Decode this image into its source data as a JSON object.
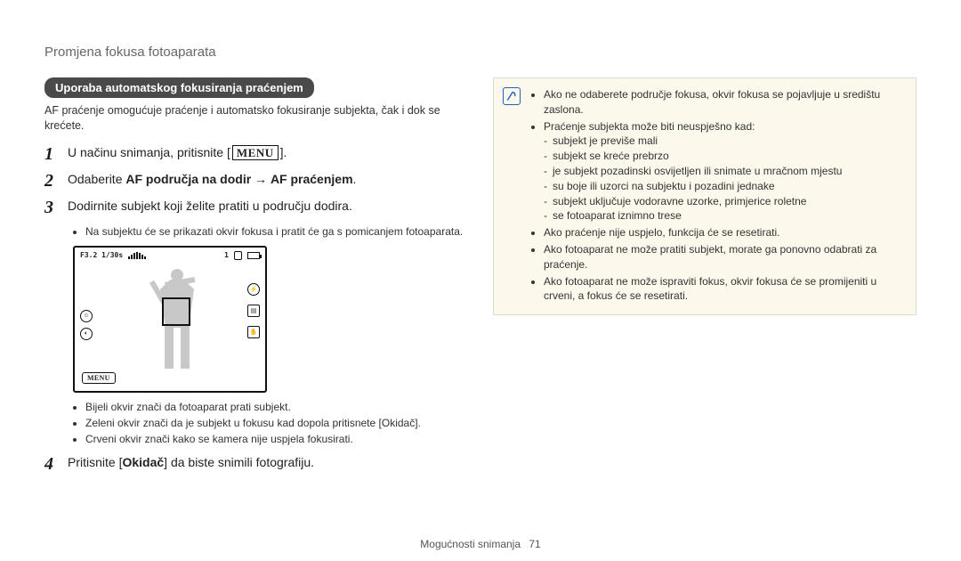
{
  "breadcrumb": "Promjena fokusa fotoaparata",
  "section_pill": "Uporaba automatskog fokusiranja praćenjem",
  "intro": "AF praćenje omogućuje praćenje i automatsko fokusiranje subjekta, čak i dok se krećete.",
  "steps": {
    "n1": "1",
    "s1_a": "U načinu snimanja, pritisnite [",
    "s1_menu": "MENU",
    "s1_b": "].",
    "n2": "2",
    "s2_a": "Odaberite ",
    "s2_b": "AF područja na dodir",
    "s2_arrow": " → ",
    "s2_c": "AF praćenjem",
    "s2_d": ".",
    "n3": "3",
    "s3": "Dodirnite subjekt koji želite pratiti u području dodira.",
    "s3_sub1": "Na subjektu će se prikazati okvir fokusa i pratit će ga s pomicanjem fotoaparata.",
    "s3_sub_a": "Bijeli okvir znači da fotoaparat prati subjekt.",
    "s3_sub_b_a": "Zeleni okvir znači da je subjekt u fokusu kad dopola pritisnete [",
    "s3_sub_b_b": "Okidač",
    "s3_sub_b_c": "].",
    "s3_sub_c": "Crveni okvir znači kako se kamera nije uspjela fokusirati.",
    "n4": "4",
    "s4_a": "Pritisnite [",
    "s4_b": "Okidač",
    "s4_c": "] da biste snimili fotografiju."
  },
  "camera": {
    "exposure": "F3.2 1/30s",
    "count": "1",
    "menu_label": "MENU"
  },
  "note": {
    "b1": "Ako ne odaberete područje fokusa, okvir fokusa se pojavljuje u središtu zaslona.",
    "b2": "Praćenje subjekta može biti neuspješno kad:",
    "d1": "subjekt je previše mali",
    "d2": "subjekt se kreće prebrzo",
    "d3": "je subjekt pozadinski osvijetljen ili snimate u mračnom mjestu",
    "d4": "su boje ili uzorci na subjektu i pozadini jednake",
    "d5": "subjekt uključuje vodoravne uzorke, primjerice roletne",
    "d6": "se fotoaparat iznimno trese",
    "b3": "Ako praćenje nije uspjelo, funkcija će se resetirati.",
    "b4": "Ako fotoaparat ne može pratiti subjekt, morate ga ponovno odabrati za praćenje.",
    "b5": "Ako fotoaparat ne može ispraviti fokus, okvir fokusa će se promijeniti u crveni, a fokus će se resetirati."
  },
  "footer": {
    "section": "Mogućnosti snimanja",
    "page": "71"
  }
}
